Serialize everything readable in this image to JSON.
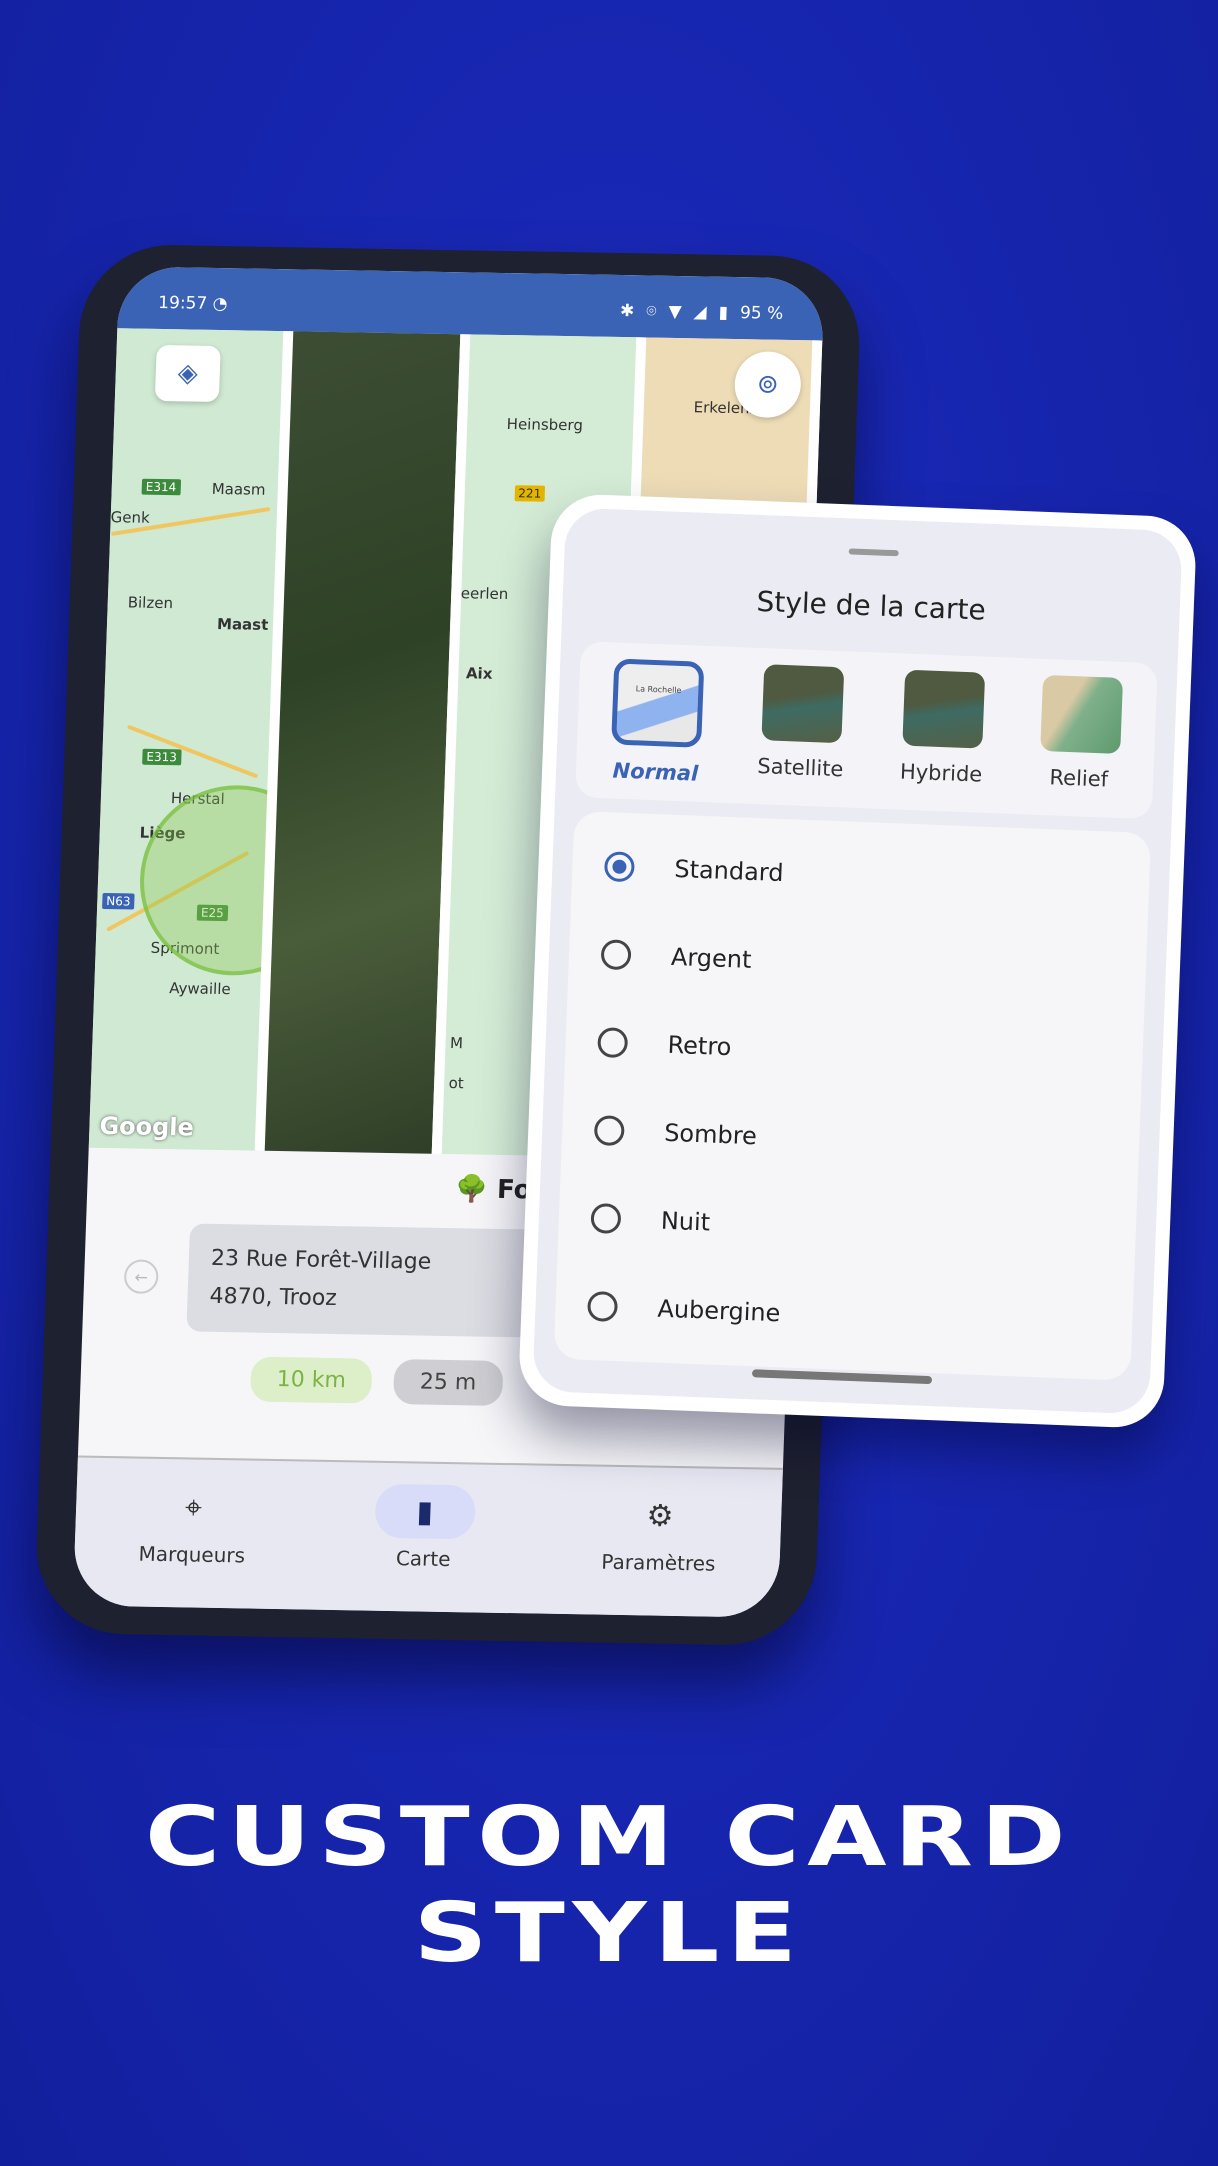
{
  "status_bar": {
    "time": "19:57",
    "battery": "95 %",
    "icons": [
      "moon-icon",
      "bluetooth-icon",
      "location-icon",
      "wifi-icon",
      "signal-icon",
      "battery-icon"
    ]
  },
  "map": {
    "labels": [
      "E314",
      "Genk",
      "Maasm",
      "Bilzen",
      "Maast",
      "E313",
      "Herstal",
      "Liège",
      "N63",
      "E25",
      "Sprimont",
      "Aywaille",
      "Heinsberg",
      "221",
      "Erkelenz",
      "eerlen",
      "Aix",
      "M",
      "ot"
    ],
    "attribution": "Google",
    "layers_button_icon": "layers-icon",
    "locate_button_icon": "crosshair-icon"
  },
  "place": {
    "title": "🌳 For",
    "address_line1": "23 Rue Forêt-Village",
    "address_line2": "4870, Trooz",
    "chips": [
      "10 km",
      "25 m"
    ]
  },
  "bottom_nav": [
    {
      "label": "Marqueurs",
      "icon": "pin-icon"
    },
    {
      "label": "Carte",
      "icon": "map-icon",
      "active": true
    },
    {
      "label": "Paramètres",
      "icon": "gear-icon"
    }
  ],
  "style_sheet": {
    "title": "Style de la carte",
    "map_types": [
      {
        "label": "Normal",
        "selected": true
      },
      {
        "label": "Satellite"
      },
      {
        "label": "Hybride"
      },
      {
        "label": "Relief"
      }
    ],
    "thumb_label": "La Rochelle",
    "variants": [
      {
        "label": "Standard",
        "selected": true
      },
      {
        "label": "Argent"
      },
      {
        "label": "Retro"
      },
      {
        "label": "Sombre"
      },
      {
        "label": "Nuit"
      },
      {
        "label": "Aubergine"
      }
    ]
  },
  "headline": {
    "line1": "CUSTOM CARD",
    "line2": "STYLE"
  },
  "colors": {
    "background": "#1626b0",
    "accent": "#3a63b5",
    "status_bar": "#3a63b5",
    "chip_green": "#dcefc8"
  }
}
